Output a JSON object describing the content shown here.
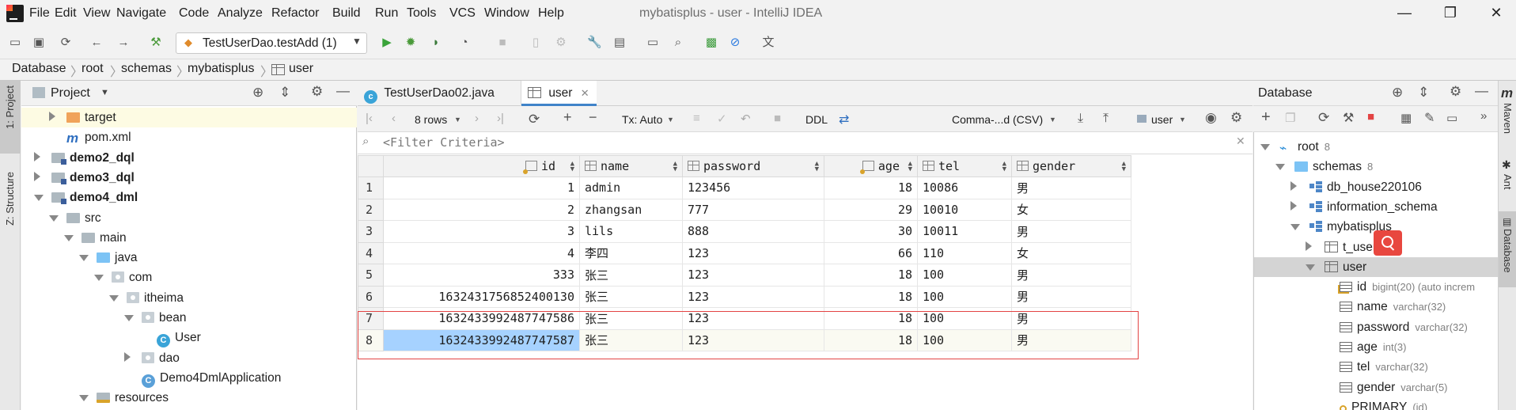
{
  "window": {
    "title": "mybatisplus - user - IntelliJ IDEA",
    "menu": [
      "File",
      "Edit",
      "View",
      "Navigate",
      "Code",
      "Analyze",
      "Refactor",
      "Build",
      "Run",
      "Tools",
      "VCS",
      "Window",
      "Help"
    ],
    "controls": {
      "minimize": "—",
      "maximize": "❐",
      "close": "✕"
    }
  },
  "toolbar": {
    "run_config": "TestUserDao.testAdd (1)"
  },
  "breadcrumb": [
    "Database",
    "root",
    "schemas",
    "mybatisplus",
    "user"
  ],
  "side_strips": {
    "left": [
      "1: Project",
      "Z: Structure"
    ],
    "right": [
      "Maven",
      "Ant",
      "Database"
    ],
    "right_logo": "m"
  },
  "project_panel": {
    "title": "Project",
    "tree": [
      {
        "label": "target",
        "depth": 2,
        "expanded": false,
        "icon": "orange-folder-icon",
        "bold": false
      },
      {
        "label": "pom.xml",
        "depth": 2,
        "expanded": null,
        "icon": "maven-file-icon",
        "bold": false
      },
      {
        "label": "demo2_dql",
        "depth": 1,
        "expanded": false,
        "icon": "module-folder-icon",
        "bold": true
      },
      {
        "label": "demo3_dql",
        "depth": 1,
        "expanded": false,
        "icon": "module-folder-icon",
        "bold": true
      },
      {
        "label": "demo4_dml",
        "depth": 1,
        "expanded": true,
        "icon": "module-folder-icon",
        "bold": true
      },
      {
        "label": "src",
        "depth": 2,
        "expanded": true,
        "icon": "folder-icon",
        "bold": false
      },
      {
        "label": "main",
        "depth": 3,
        "expanded": true,
        "icon": "folder-icon",
        "bold": false
      },
      {
        "label": "java",
        "depth": 4,
        "expanded": true,
        "icon": "blue-folder-icon",
        "bold": false
      },
      {
        "label": "com",
        "depth": 5,
        "expanded": true,
        "icon": "package-icon",
        "bold": false
      },
      {
        "label": "itheima",
        "depth": 6,
        "expanded": true,
        "icon": "package-icon",
        "bold": false
      },
      {
        "label": "bean",
        "depth": 7,
        "expanded": true,
        "icon": "package-icon",
        "bold": false
      },
      {
        "label": "User",
        "depth": 8,
        "expanded": null,
        "icon": "class-icon",
        "bold": false
      },
      {
        "label": "dao",
        "depth": 7,
        "expanded": false,
        "icon": "package-icon",
        "bold": false
      },
      {
        "label": "Demo4DmlApplication",
        "depth": 7,
        "expanded": null,
        "icon": "spring-class-icon",
        "bold": false
      },
      {
        "label": "resources",
        "depth": 4,
        "expanded": true,
        "icon": "resources-folder-icon",
        "bold": false
      }
    ]
  },
  "editor": {
    "tabs": [
      {
        "label": "TestUserDao02.java",
        "active": false
      },
      {
        "label": "user",
        "active": true
      }
    ],
    "grid_toolbar": {
      "rows_label": "8 rows",
      "tx_label": "Tx: Auto",
      "ddl_label": "DDL",
      "export_format": "Comma-...d (CSV)",
      "schema_select": "user"
    },
    "filter_placeholder": "<Filter Criteria>",
    "columns": [
      "id",
      "name",
      "password",
      "age",
      "tel",
      "gender"
    ],
    "rows": [
      [
        "1",
        "1",
        "admin",
        "123456",
        "18",
        "10086",
        "男"
      ],
      [
        "2",
        "2",
        "zhangsan",
        "777",
        "29",
        "10010",
        "女"
      ],
      [
        "3",
        "3",
        "lils",
        "888",
        "30",
        "10011",
        "男"
      ],
      [
        "4",
        "4",
        "李四",
        "123",
        "66",
        "110",
        "女"
      ],
      [
        "5",
        "333",
        "张三",
        "123",
        "18",
        "100",
        "男"
      ],
      [
        "6",
        "1632431756852400130",
        "张三",
        "123",
        "18",
        "100",
        "男"
      ],
      [
        "7",
        "1632433992487747586",
        "张三",
        "123",
        "18",
        "100",
        "男"
      ],
      [
        "8",
        "1632433992487747587",
        "张三",
        "123",
        "18",
        "100",
        "男"
      ]
    ],
    "selected_row": 8
  },
  "database_panel": {
    "title": "Database",
    "tree": [
      {
        "label": "root",
        "extra": "8",
        "depth": 0,
        "expanded": true,
        "icon": "datasource-icon"
      },
      {
        "label": "schemas",
        "extra": "8",
        "depth": 1,
        "expanded": true,
        "icon": "folder-icon"
      },
      {
        "label": "db_house220106",
        "extra": "",
        "depth": 2,
        "expanded": false,
        "icon": "schema-icon"
      },
      {
        "label": "information_schema",
        "extra": "",
        "depth": 2,
        "expanded": false,
        "icon": "schema-icon"
      },
      {
        "label": "mybatisplus",
        "extra": "",
        "depth": 2,
        "expanded": true,
        "icon": "schema-icon"
      },
      {
        "label": "t_user",
        "extra": "",
        "depth": 3,
        "expanded": false,
        "icon": "table-icon"
      },
      {
        "label": "user",
        "extra": "",
        "depth": 3,
        "expanded": true,
        "icon": "table-icon",
        "selected": true
      },
      {
        "label": "id",
        "extra": "bigint(20) (auto increm",
        "depth": 4,
        "expanded": null,
        "icon": "key-column-icon"
      },
      {
        "label": "name",
        "extra": "varchar(32)",
        "depth": 4,
        "expanded": null,
        "icon": "column-icon"
      },
      {
        "label": "password",
        "extra": "varchar(32)",
        "depth": 4,
        "expanded": null,
        "icon": "column-icon"
      },
      {
        "label": "age",
        "extra": "int(3)",
        "depth": 4,
        "expanded": null,
        "icon": "column-icon"
      },
      {
        "label": "tel",
        "extra": "varchar(32)",
        "depth": 4,
        "expanded": null,
        "icon": "column-icon"
      },
      {
        "label": "gender",
        "extra": "varchar(5)",
        "depth": 4,
        "expanded": null,
        "icon": "column-icon"
      },
      {
        "label": "PRIMARY",
        "extra": "(id)",
        "depth": 4,
        "expanded": null,
        "icon": "key-icon"
      }
    ]
  },
  "colors": {
    "selection": "#a6d2ff",
    "highlight_border": "#e34444",
    "search_badge": "#e8473f",
    "hover_row": "#fdfbe3"
  }
}
